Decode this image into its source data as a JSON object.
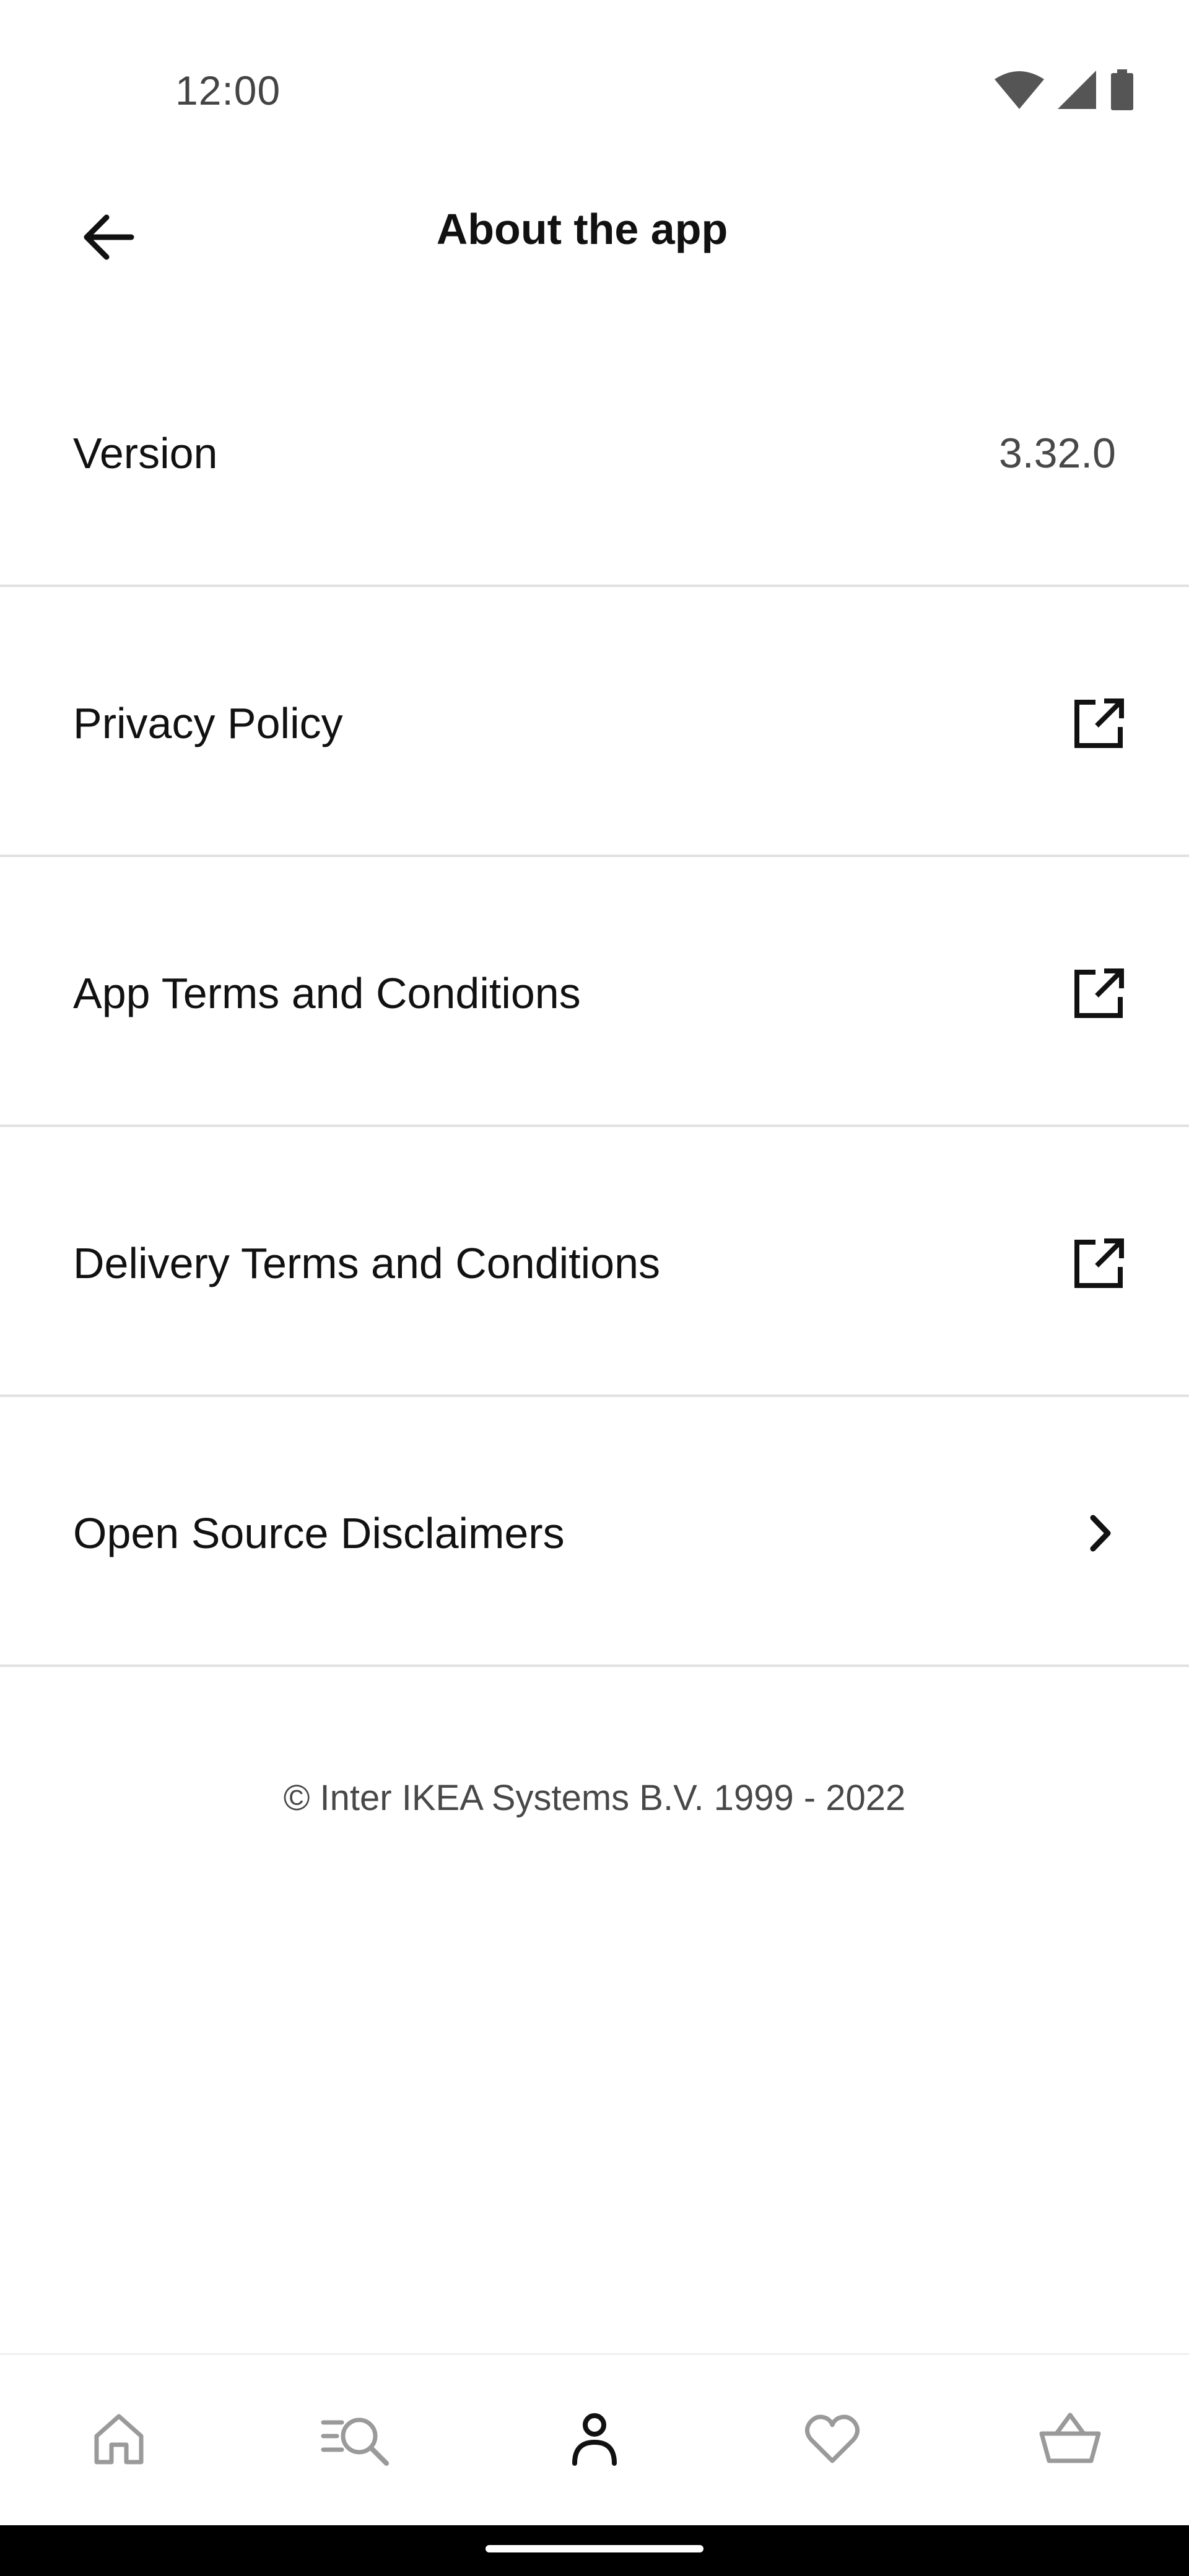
{
  "status_bar": {
    "time": "12:00",
    "icons": [
      "wifi-icon",
      "cellular-signal-icon",
      "battery-icon"
    ]
  },
  "app_bar": {
    "title": "About the app",
    "back_icon": "arrow-left-icon"
  },
  "rows": [
    {
      "label": "Version",
      "value": "3.32.0"
    },
    {
      "label": "Privacy Policy",
      "icon": "external-link-icon"
    },
    {
      "label": "App Terms and Conditions",
      "icon": "external-link-icon"
    },
    {
      "label": "Delivery Terms and Conditions",
      "icon": "external-link-icon"
    },
    {
      "label": "Open Source Disclaimers",
      "icon": "chevron-right-icon"
    }
  ],
  "copyright": "© Inter IKEA Systems B.V. 1999 - 2022",
  "bottom_nav": {
    "items": [
      {
        "icon": "home-icon",
        "active": false
      },
      {
        "icon": "search-icon",
        "active": false
      },
      {
        "icon": "profile-icon",
        "active": true
      },
      {
        "icon": "heart-icon",
        "active": false
      },
      {
        "icon": "basket-icon",
        "active": false
      }
    ]
  },
  "colors": {
    "text": "#111111",
    "secondary_text": "#484848",
    "divider": "#e1e1e1",
    "inactive_icon": "#9a9a9a"
  }
}
